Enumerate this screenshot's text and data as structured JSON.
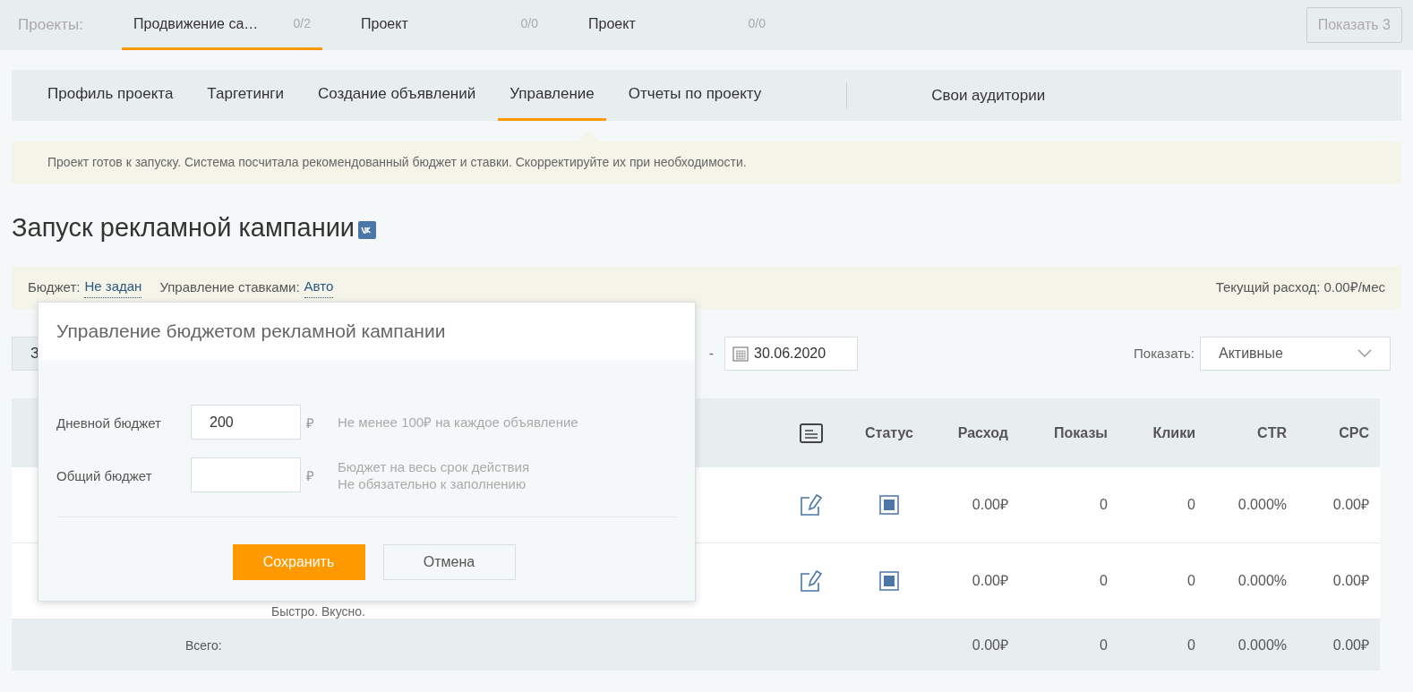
{
  "projects": {
    "label": "Проекты:",
    "tabs": [
      {
        "name": "Продвижение са…",
        "count": "0/2",
        "selected": true
      },
      {
        "name": "Проект",
        "count": "0/0",
        "selected": false
      },
      {
        "name": "Проект",
        "count": "0/0",
        "selected": false
      }
    ],
    "show_more": "Показать 3"
  },
  "nav": {
    "tabs": [
      {
        "label": "Профиль проекта",
        "selected": false
      },
      {
        "label": "Таргетинги",
        "selected": false
      },
      {
        "label": "Создание объявлений",
        "selected": false
      },
      {
        "label": "Управление",
        "selected": true
      },
      {
        "label": "Отчеты по проекту",
        "selected": false
      }
    ],
    "extra": "Свои аудитории"
  },
  "notice": "Проект готов к запуску. Система посчитала рекомендованный бюджет и ставки. Скорректируйте их при необходимости.",
  "title": "Запуск рекламной кампании",
  "budget_bar": {
    "budget_label": "Бюджет:",
    "budget_value": "Не задан",
    "bid_label": "Управление ставками:",
    "bid_value": "Авто",
    "spend": "Текущий расход: 0.00₽/мес"
  },
  "toolbar": {
    "button": "З",
    "dash": "-",
    "date": "30.06.2020",
    "show_label": "Показать:",
    "show_value": "Активные"
  },
  "table": {
    "columns": [
      "Статус",
      "Расход",
      "Показы",
      "Клики",
      "CTR",
      "CPC"
    ],
    "rows": [
      {
        "values": [
          "0.00₽",
          "0",
          "0",
          "0.000%",
          "0.00₽"
        ]
      },
      {
        "text": "Быстро. Вкусно.",
        "values": [
          "0.00₽",
          "0",
          "0",
          "0.000%",
          "0.00₽"
        ]
      }
    ],
    "total": {
      "label": "Всего:",
      "values": [
        "0.00₽",
        "0",
        "0",
        "0.000%",
        "0.00₽"
      ]
    }
  },
  "modal": {
    "title": "Управление бюджетом рекламной кампании",
    "fields": [
      {
        "label": "Дневной бюджет",
        "value": "200",
        "currency": "₽",
        "hints": [
          "Не менее 100₽ на каждое объявление"
        ]
      },
      {
        "label": "Общий бюджет",
        "currency": "₽",
        "hints": [
          "Бюджет на весь срок действия",
          "Не обязательно к заполнению"
        ]
      }
    ],
    "save": "Сохранить",
    "cancel": "Отмена"
  }
}
